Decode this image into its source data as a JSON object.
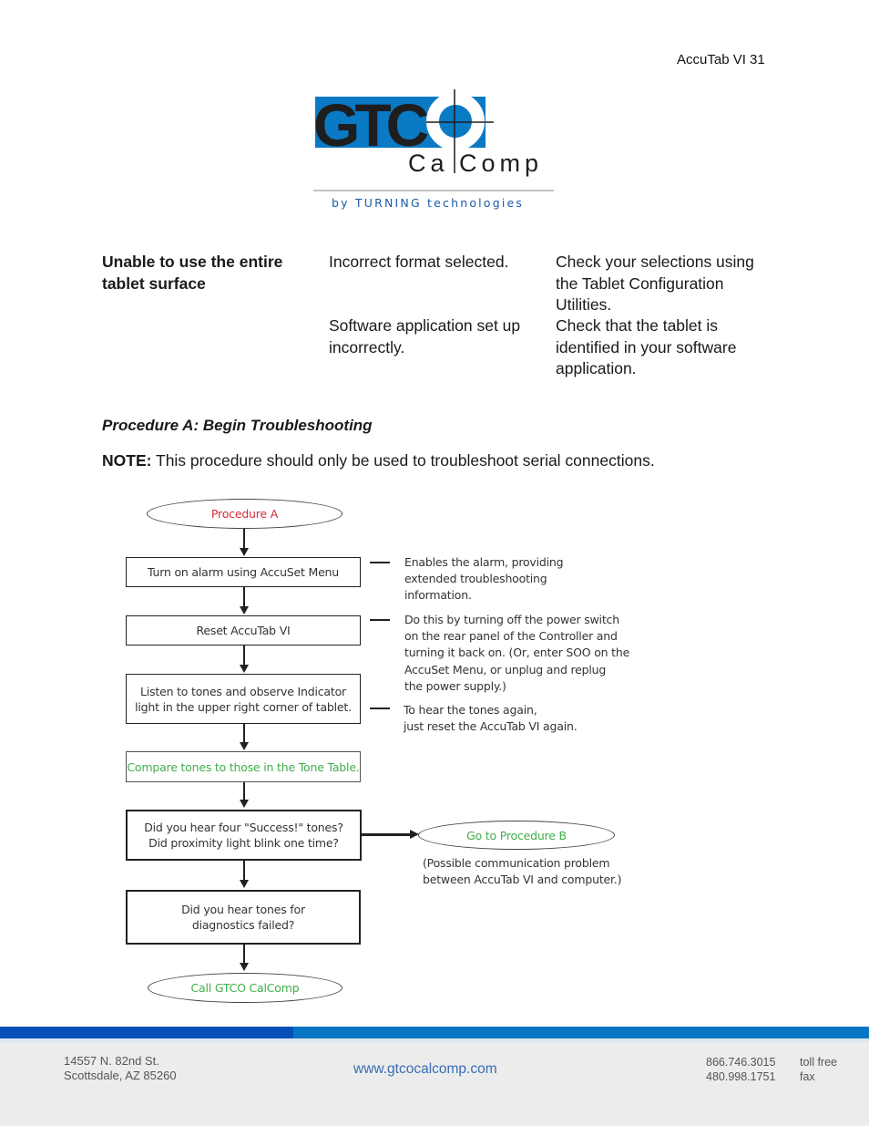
{
  "header": {
    "page_label": "AccuTab VI 31"
  },
  "logo": {
    "wordmark": "GTCO",
    "subword": "CalComp",
    "subword_left": "Ca",
    "subword_right": "Comp",
    "tagline": "by TURNING technologies",
    "colors": {
      "blue": "#0a7ac4",
      "black": "#1e1e1e"
    }
  },
  "troubleshooting_table": {
    "problem": "Unable to use the entire tablet surface",
    "rows": [
      {
        "cause": "Incorrect format selected.",
        "solution": "Check your selections using the Tablet Configuration Utilities."
      },
      {
        "cause": "Software application set up incorrectly.",
        "solution": "Check that the tablet is identified in your software application."
      }
    ]
  },
  "procedure": {
    "title": "Procedure A: Begin Troubleshooting",
    "note_label": "NOTE:",
    "note_text": " This procedure should only be used to troubleshoot serial connections."
  },
  "flowchart": {
    "start": "Procedure A",
    "steps": [
      "Turn on alarm using AccuSet Menu",
      "Reset AccuTab VI",
      "Listen to tones and observe Indicator light in the upper right corner of tablet.",
      "Compare tones to those in the Tone Table.",
      "Did you hear four \"Success!\" tones? Did proximity light blink one time?",
      "Did you hear tones for diagnostics failed?"
    ],
    "steps_lines": [
      [
        "Turn on alarm using AccuSet Menu"
      ],
      [
        "Reset AccuTab VI"
      ],
      [
        "Listen to tones and observe Indicator",
        "light in the upper right corner of tablet."
      ],
      [
        "Compare tones to those in the Tone Table."
      ],
      [
        "Did you hear four \"Success!\" tones?",
        "Did proximity light blink one time?"
      ],
      [
        "Did you hear tones for",
        "diagnostics failed?"
      ]
    ],
    "branch": "Go to Procedure B",
    "branch_note_lines": [
      "(Possible communication problem",
      "between AccuTab VI and computer.)"
    ],
    "end": "Call GTCO CalComp",
    "annotations": [
      {
        "lines": [
          "Enables the alarm, providing",
          "extended troubleshooting",
          "information."
        ]
      },
      {
        "lines": [
          "Do this by turning off the power switch",
          "on the rear panel of the Controller and",
          "turning it back on. (Or, enter SOO on the",
          "AccuSet Menu, or unplug and replug",
          "the power supply.)"
        ]
      },
      {
        "lines": [
          "To hear the tones again,",
          "just reset the AccuTab VI again."
        ]
      }
    ],
    "colors": {
      "start_text": "#d62b3a",
      "highlight_text": "#3fae49"
    }
  },
  "footer": {
    "address_lines": [
      "14557 N. 82nd St.",
      "Scottsdale, AZ 85260"
    ],
    "website": "www.gtcocalcomp.com",
    "phones": [
      "866.746.3015",
      "480.998.1751"
    ],
    "phone_labels": [
      "toll free",
      "fax"
    ],
    "colors": {
      "bar_left": "#0550b8",
      "bar_right": "#0575c4",
      "background": "#ececec",
      "link": "#3a6db5"
    }
  }
}
